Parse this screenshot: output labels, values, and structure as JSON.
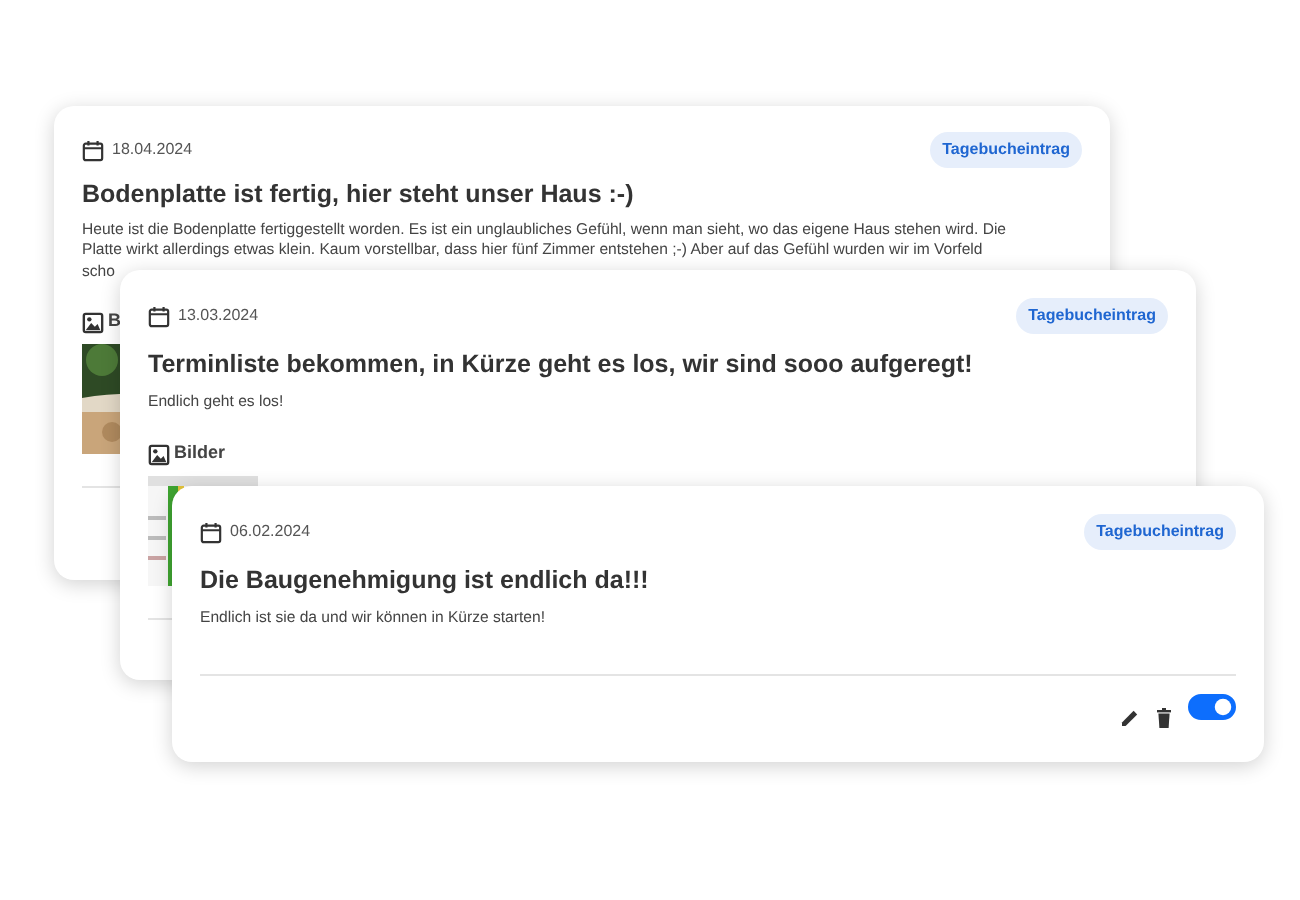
{
  "entries": [
    {
      "date": "18.04.2024",
      "badge": "Tagebucheintrag",
      "title": "Bodenplatte ist fertig, hier steht unser Haus :-)",
      "text_lines": [
        "Heute ist die Bodenplatte fertiggestellt worden. Es ist ein unglaubliches Gefühl, wenn man sieht, wo das eigene Haus stehen wird. Die",
        "Platte wirkt allerdings etwas klein. Kaum vorstellbar, dass hier fünf Zimmer entstehen ;-) Aber auf das Gefühl wurden wir im Vorfeld",
        "scho"
      ],
      "images": {
        "heading": "B"
      }
    },
    {
      "date": "13.03.2024",
      "badge": "Tagebucheintrag",
      "title": "Terminliste bekommen, in Kürze geht es los, wir sind sooo aufgeregt!",
      "text": "Endlich geht es los!",
      "images": {
        "heading": "Bilder",
        "pictures": [
          {
            "kind": "sheet"
          }
        ]
      }
    },
    {
      "date": "06.02.2024",
      "badge": "Tagebucheintrag",
      "title": "Die Baugenehmigung ist endlich da!!!",
      "text": "Endlich ist sie da und wir können in Kürze starten!",
      "actions": {
        "toggle_on": true
      }
    }
  ]
}
